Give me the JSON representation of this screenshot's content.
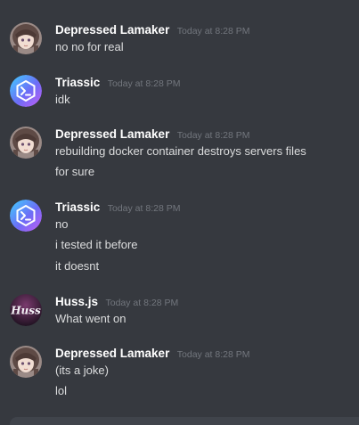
{
  "messages": [
    {
      "author": "Depressed Lamaker",
      "timestamp": "Today at 8:28 PM",
      "avatar_icon": "anime-girl-avatar-icon",
      "lines": [
        "no no for real"
      ]
    },
    {
      "author": "Triassic",
      "timestamp": "Today at 8:28 PM",
      "avatar_icon": "terminal-prompt-avatar-icon",
      "lines": [
        "idk"
      ]
    },
    {
      "author": "Depressed Lamaker",
      "timestamp": "Today at 8:28 PM",
      "avatar_icon": "anime-girl-avatar-icon",
      "lines": [
        "rebuilding docker container destroys servers files",
        "for sure"
      ]
    },
    {
      "author": "Triassic",
      "timestamp": "Today at 8:28 PM",
      "avatar_icon": "terminal-prompt-avatar-icon",
      "lines": [
        "no",
        "i tested it before",
        "it doesnt"
      ]
    },
    {
      "author": "Huss.js",
      "timestamp": "Today at 8:28 PM",
      "avatar_icon": "huss-logo-avatar-icon",
      "avatar_text": "Huss",
      "lines": [
        "What went on"
      ]
    },
    {
      "author": "Depressed Lamaker",
      "timestamp": "Today at 8:28 PM",
      "avatar_icon": "anime-girl-avatar-icon",
      "lines": [
        "(its a joke)",
        "lol"
      ]
    }
  ],
  "colors": {
    "background": "#36393f",
    "author": "#ffffff",
    "timestamp": "#72767d",
    "message_text": "#dcddde",
    "composer": "#40444b"
  }
}
